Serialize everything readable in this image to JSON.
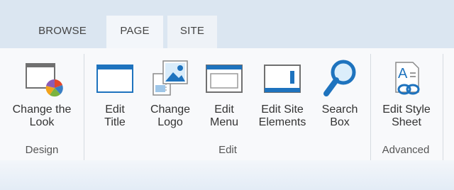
{
  "tabs": [
    {
      "label": "BROWSE"
    },
    {
      "label": "PAGE"
    },
    {
      "label": "SITE"
    }
  ],
  "groups": [
    {
      "label": "Design"
    },
    {
      "label": "Edit"
    },
    {
      "label": "Advanced"
    }
  ],
  "buttons": {
    "change_look": {
      "line1": "Change the",
      "line2": "Look",
      "icon": "change-look-icon"
    },
    "edit_title": {
      "line1": "Edit",
      "line2": "Title",
      "icon": "edit-title-icon"
    },
    "change_logo": {
      "line1": "Change",
      "line2": "Logo",
      "icon": "change-logo-icon"
    },
    "edit_menu": {
      "line1": "Edit",
      "line2": "Menu",
      "icon": "edit-menu-icon"
    },
    "edit_site_elements": {
      "line1": "Edit Site",
      "line2": "Elements",
      "icon": "edit-site-elements-icon"
    },
    "search_box": {
      "line1": "Search",
      "line2": "Box",
      "icon": "search-icon"
    },
    "edit_style_sheet": {
      "line1": "Edit Style",
      "line2": "Sheet",
      "icon": "style-sheet-icon"
    }
  },
  "colors": {
    "accent_blue": "#1e73be",
    "tab_bar": "#dbe6f1",
    "ribbon_bg": "#f8f9fb"
  }
}
